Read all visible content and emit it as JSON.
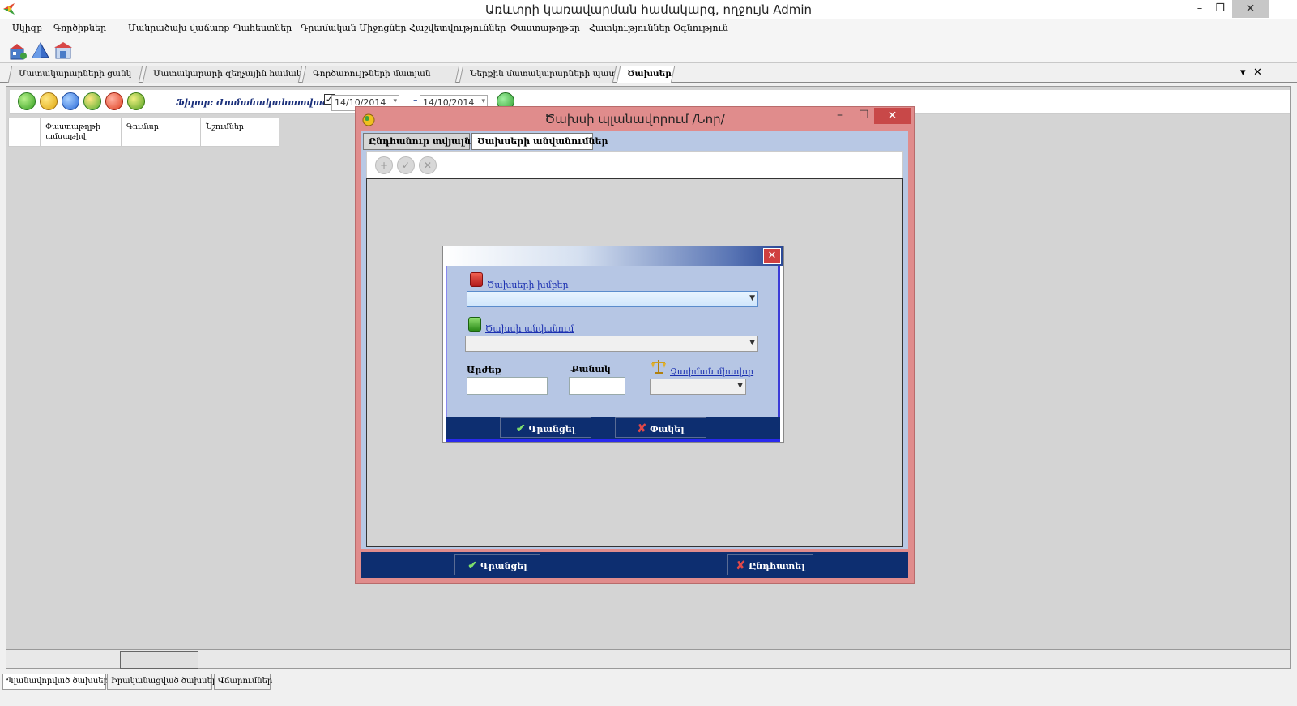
{
  "window": {
    "title": "Առևտրի կառավարման համակարգ, ողջույն Admin",
    "minimize": "–",
    "restore": "❐",
    "close": "✕"
  },
  "menu": [
    "Սկիզբ",
    "Գործիքներ",
    "Մանրածախ վաճառք",
    "Պահեստներ",
    "Դրամական Միջոցներ",
    "Հաշվետվություններ",
    "Փաստաթղթեր",
    "Հատկություններ",
    "Օգնություն"
  ],
  "toolbar_icons": [
    "clients-icon",
    "products-icon",
    "warehouse-icon"
  ],
  "doc_tabs": [
    {
      "label": "Մատակարարների ցանկ",
      "active": false
    },
    {
      "label": "Մատակարարի զեղչային համակ...",
      "active": false
    },
    {
      "label": "Գործառույթների մատյան",
      "active": false
    },
    {
      "label": "Ներքին մատակարարների պատվ...",
      "active": false
    },
    {
      "label": "Ծախսեր",
      "active": true
    }
  ],
  "tab_controls": {
    "dropdown": "▾",
    "close": "✕"
  },
  "content_toolbar": {
    "filter_label": "Ֆիլտր: Ժամանակահատված՝",
    "checkbox": "✓",
    "date_from": "14/10/2014",
    "date_separator": "–",
    "date_to": "14/10/2014",
    "date_dropdown": "▾"
  },
  "grid_columns": [
    "Փաստաթղթի ամսաթիվ",
    "Գումար",
    "Նշումներ"
  ],
  "bottom_tabs": [
    {
      "label": "Պլանավորված ծախսեր",
      "active": true
    },
    {
      "label": "Իրականացված ծախսեր",
      "active": false
    },
    {
      "label": "Վճարումներ",
      "active": false
    }
  ],
  "dialog": {
    "title": "Ծախսի պլանավորում /Նոր/",
    "minimize": "–",
    "maximize": "☐",
    "close": "✕",
    "tabs": [
      {
        "label": "Ընդհանուր տվյալներ",
        "active": false
      },
      {
        "label": "Ծախսերի անվանումներ",
        "active": true
      }
    ],
    "toolbar_buttons": [
      "+",
      "✓",
      "✕"
    ],
    "ok_label": "Գրանցել",
    "cancel_label": "Ընդհատել"
  },
  "sub_dialog": {
    "close": "✕",
    "group_link": "Ծախսերի խմբեր",
    "name_link": "Ծախսի անվանում",
    "value_label": "Արժեք",
    "qty_label": "Քանակ",
    "unit_link": "Չափման միավոր",
    "ok_label": "Գրանցել",
    "close_label": "Փակել"
  },
  "icons": {
    "check": "✔",
    "cross": "✘",
    "arrow": "▼"
  }
}
